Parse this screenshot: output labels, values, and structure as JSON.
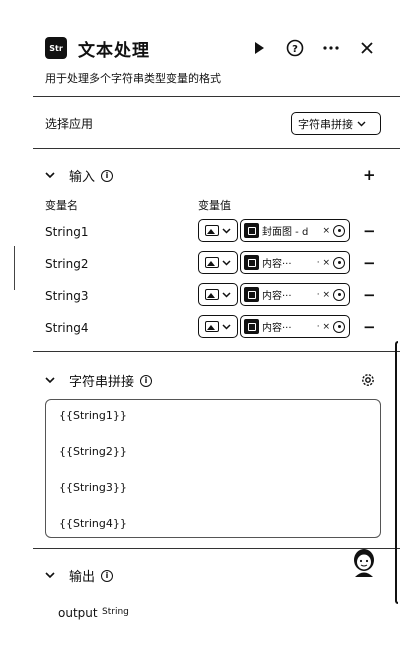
{
  "header": {
    "logo_text": "Str",
    "title": "文本处理",
    "subtitle": "用于处理多个字符串类型变量的格式"
  },
  "select_app": {
    "label": "选择应用",
    "value": "字符串拼接"
  },
  "input_section": {
    "title": "输入",
    "col_name": "变量名",
    "col_value": "变量值",
    "rows": [
      {
        "name": "String1",
        "value": "封面图 - d",
        "clear": "×"
      },
      {
        "name": "String2",
        "value": "内容···",
        "clear": "· ×"
      },
      {
        "name": "String3",
        "value": "内容···",
        "clear": "· ×"
      },
      {
        "name": "String4",
        "value": "内容···",
        "clear": "· ×"
      }
    ]
  },
  "concat_section": {
    "title": "字符串拼接",
    "lines": [
      "{{String1}}",
      "{{String2}}",
      "{{String3}}",
      "{{String4}}"
    ]
  },
  "output_section": {
    "title": "输出",
    "var_name": "output",
    "var_type": "String"
  },
  "icons": {
    "run": "play-icon",
    "help": "help-icon",
    "more": "more-icon",
    "close": "close-icon"
  }
}
